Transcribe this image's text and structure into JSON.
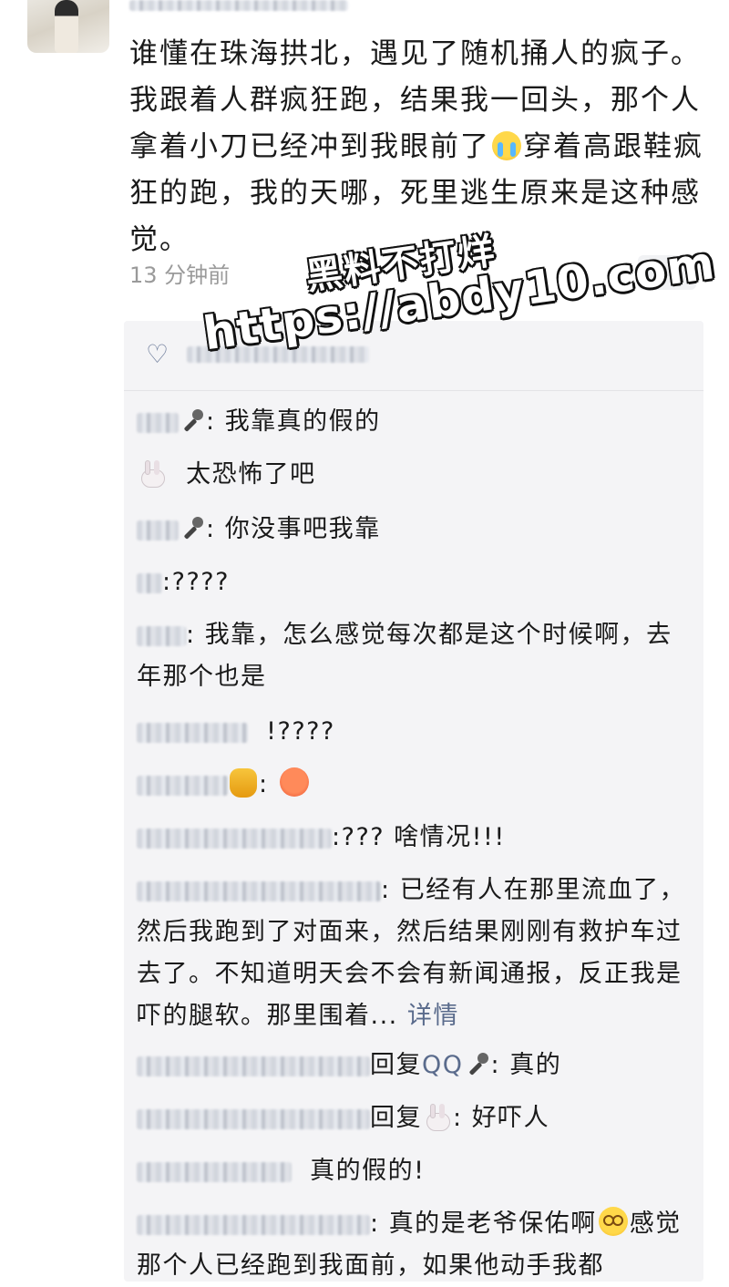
{
  "post": {
    "text_before_emoji": "谁懂在珠海拱北，遇见了随机捅人的疯子。我跟着人群疯狂跑，结果我一回头，那个人拿着小刀已经冲到我眼前了",
    "emoji_1": "crying-face-emoji",
    "text_after_emoji": "穿着高跟鞋疯狂的跑，我的天哪，死里逃生原来是这种感觉。",
    "time": "13 分钟前",
    "more_label": "••"
  },
  "watermark": {
    "line1": "黑料不打烊",
    "line2": "https://abdy10.com"
  },
  "likes": {
    "icon": "heart-icon"
  },
  "comments": [
    {
      "text": "我靠真的假的",
      "sep": ": "
    },
    {
      "text": "太恐怖了吧"
    },
    {
      "text": "你没事吧我靠",
      "sep": ": "
    },
    {
      "text": "????",
      "sep": ":"
    },
    {
      "text": "我靠，怎么感觉每次都是这个时候啊，去年那个也是",
      "sep": ": "
    },
    {
      "text": "!????"
    },
    {
      "sep": ":"
    },
    {
      "text": "??? 啥情况!!!",
      "sep": ":"
    },
    {
      "text": "已经有人在那里流血了，然后我跑到了对面来，然后结果刚刚有救护车过去了。不知道明天会不会有新闻通报，反正我是吓的腿软。那里围着...",
      "more": "详情",
      "sep": ": "
    },
    {
      "reply_prefix": "回复",
      "reply_to": "QQ",
      "text": "真的",
      "sep": ": "
    },
    {
      "reply_prefix": "回复",
      "text": "好吓人",
      "sep": ": "
    },
    {
      "text": "真的假的!"
    },
    {
      "text_before": "真的是老爷保佑啊",
      "text_after": "感觉那个人已经跑到我面前，如果他动手我都",
      "sep": ": "
    }
  ]
}
